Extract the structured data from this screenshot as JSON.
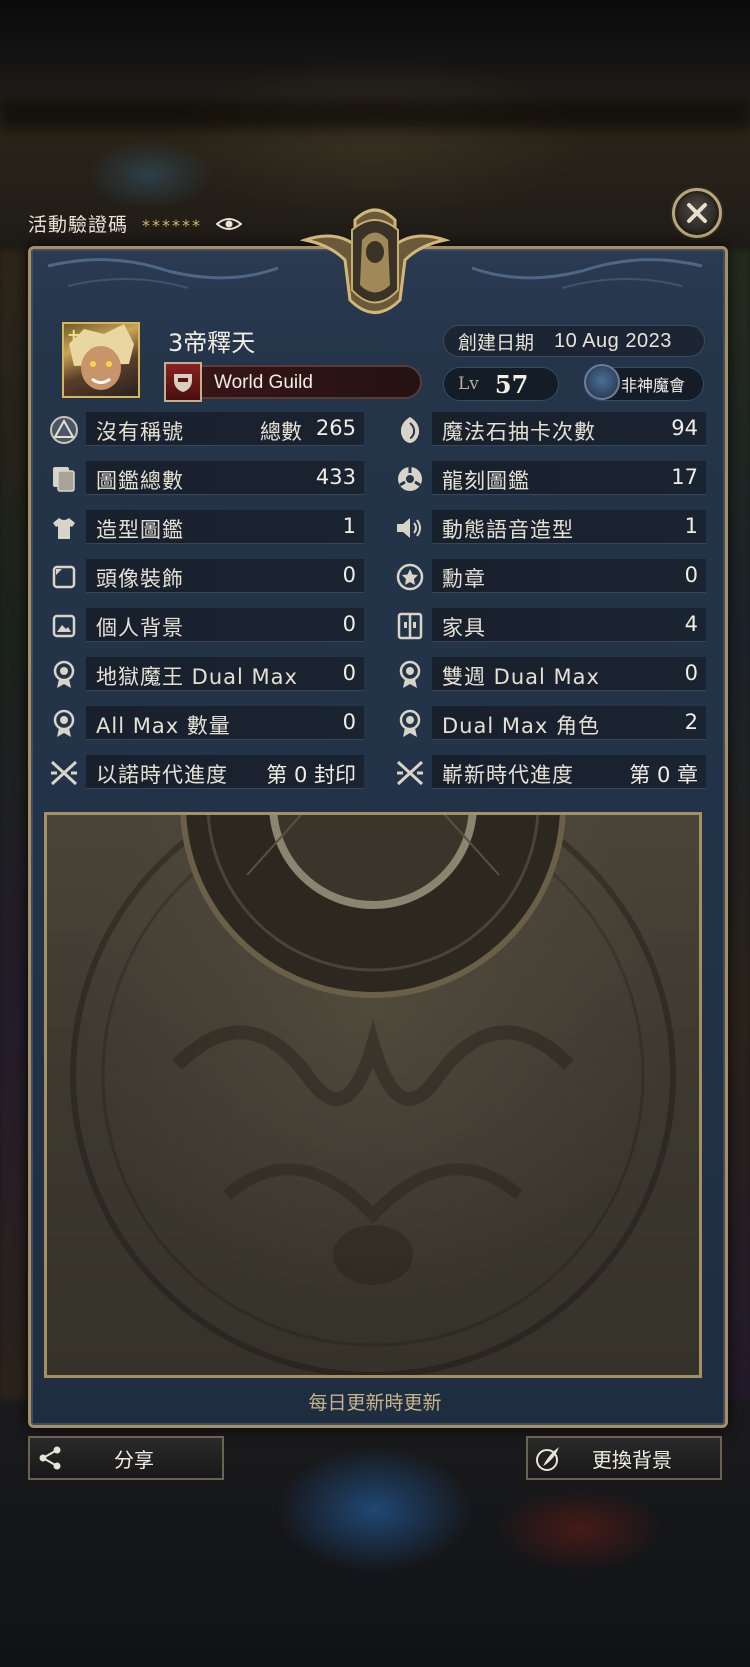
{
  "header": {
    "code_label": "活動驗證碼",
    "code_value": "******"
  },
  "profile": {
    "name": "3帝釋天",
    "guild": "World Guild",
    "created_label": "創建日期",
    "created_date": "10 Aug 2023",
    "lv_label": "Lv",
    "lv_value": "57",
    "god_status": "非神魔會"
  },
  "stats_left": [
    {
      "icon": "triangle-emblem-icon",
      "label": "沒有稱號",
      "mid": "總數",
      "value": "265"
    },
    {
      "icon": "cards-icon",
      "label": "圖鑑總數",
      "value": "433"
    },
    {
      "icon": "shirt-icon",
      "label": "造型圖鑑",
      "value": "1"
    },
    {
      "icon": "avatar-frame-icon",
      "label": "頭像裝飾",
      "value": "0"
    },
    {
      "icon": "picture-icon",
      "label": "個人背景",
      "value": "0"
    },
    {
      "icon": "medal-icon",
      "label": "地獄魔王 Dual Max",
      "value": "0"
    },
    {
      "icon": "medal-icon",
      "label": "All Max 數量",
      "value": "0"
    },
    {
      "icon": "crossed-swords-icon",
      "label": "以諾時代進度",
      "value": "第 0 封印"
    }
  ],
  "stats_right": [
    {
      "icon": "magic-stone-icon",
      "label": "魔法石抽卡次數",
      "value": "94"
    },
    {
      "icon": "dragon-emblem-icon",
      "label": "龍刻圖鑑",
      "value": "17"
    },
    {
      "icon": "speaker-icon",
      "label": "動態語音造型",
      "value": "1"
    },
    {
      "icon": "star-badge-icon",
      "label": "勳章",
      "value": "0"
    },
    {
      "icon": "furniture-icon",
      "label": "家具",
      "value": "4"
    },
    {
      "icon": "medal-icon",
      "label": "雙週 Dual Max",
      "value": "0"
    },
    {
      "icon": "medal-icon",
      "label": "Dual Max 角色",
      "value": "2"
    },
    {
      "icon": "crossed-swords-icon",
      "label": "嶄新時代進度",
      "value": "第 0 章"
    }
  ],
  "footer": {
    "update_note": "每日更新時更新",
    "share_label": "分享",
    "change_bg_label": "更換背景"
  },
  "colors": {
    "panel": "#243449",
    "gold": "#a68f62",
    "text": "#f1ede3"
  }
}
